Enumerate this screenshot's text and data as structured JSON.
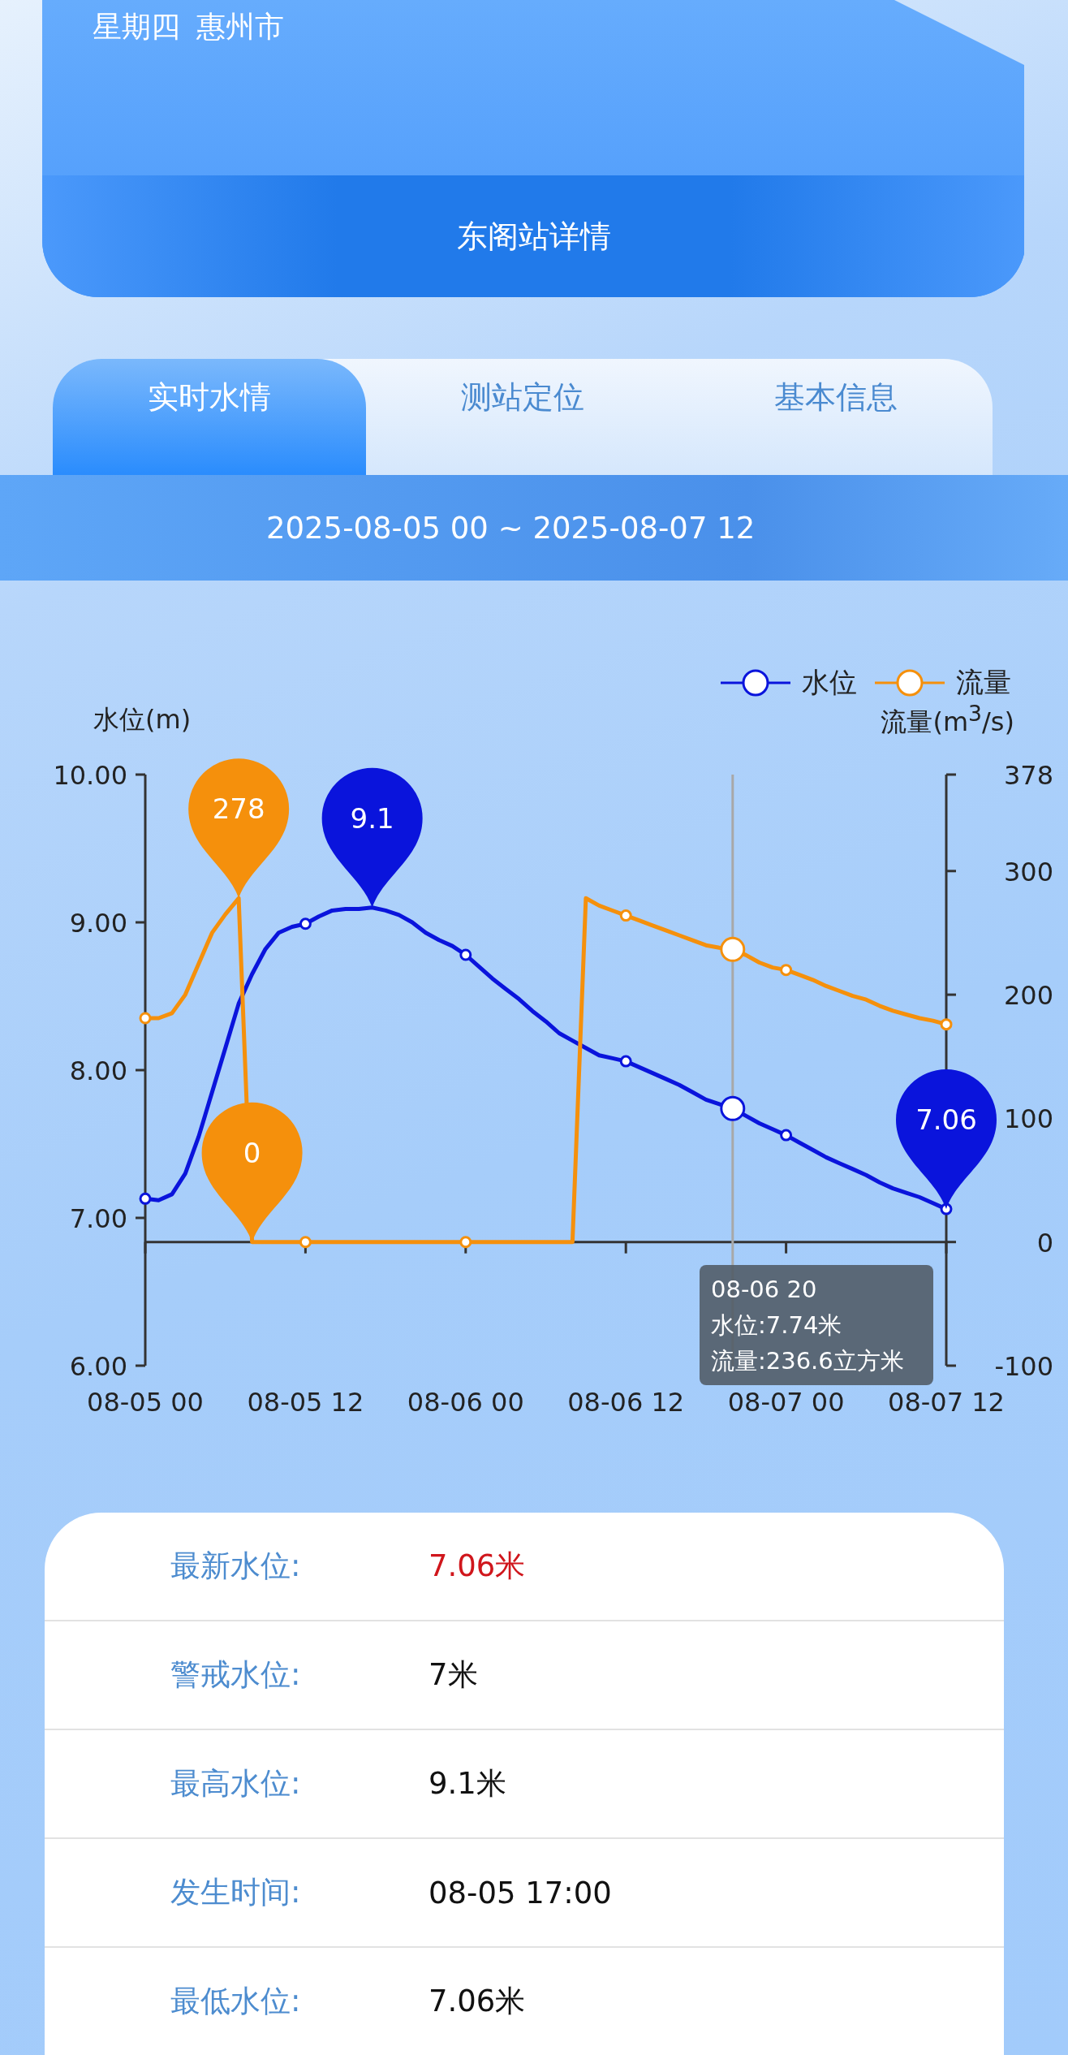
{
  "header": {
    "weekday": "星期四",
    "city": "惠州市",
    "station_title": "东阁站详情"
  },
  "tabs": [
    {
      "label": "实时水情",
      "selected": true
    },
    {
      "label": "测站定位",
      "selected": false
    },
    {
      "label": "基本信息",
      "selected": false
    }
  ],
  "date_range": "2025-08-05 00 ~ 2025-08-07 12",
  "chart": {
    "chart_data": {
      "type": "line",
      "ylabel": "水位(m)",
      "y2label": "流量(m$^{3}$/s)",
      "categories": [
        "08-05 00",
        null,
        null,
        null,
        null,
        null,
        null,
        null,
        null,
        null,
        null,
        null,
        "08-05 12",
        null,
        null,
        null,
        null,
        null,
        null,
        null,
        null,
        null,
        null,
        null,
        "08-06 00",
        null,
        null,
        null,
        null,
        null,
        null,
        null,
        null,
        null,
        null,
        null,
        "08-06 12",
        null,
        null,
        null,
        null,
        null,
        null,
        null,
        null,
        null,
        null,
        null,
        "08-07 00",
        null,
        null,
        null,
        null,
        null,
        null,
        null,
        null,
        null,
        null,
        null,
        "08-07 12"
      ],
      "series": [
        {
          "name": "水位",
          "color": "#0a14dc",
          "values": [
            7.13,
            7.12,
            7.16,
            7.3,
            7.55,
            7.85,
            8.15,
            8.45,
            8.65,
            8.82,
            8.93,
            8.97,
            8.99,
            9.04,
            9.08,
            9.09,
            9.09,
            9.1,
            9.08,
            9.05,
            9.0,
            8.93,
            8.88,
            8.84,
            8.78,
            8.7,
            8.62,
            8.55,
            8.48,
            8.4,
            8.33,
            8.25,
            8.2,
            8.15,
            8.1,
            8.08,
            8.06,
            8.02,
            7.98,
            7.94,
            7.9,
            7.85,
            7.8,
            7.77,
            7.74,
            7.69,
            7.64,
            7.6,
            7.56,
            7.51,
            7.46,
            7.41,
            7.37,
            7.33,
            7.29,
            7.24,
            7.2,
            7.17,
            7.14,
            7.1,
            7.06
          ]
        },
        {
          "name": "流量",
          "color": "#f5900c",
          "axis": "y2",
          "values": [
            181,
            181,
            185,
            200,
            225,
            250,
            265,
            278,
            0,
            0,
            0,
            0,
            0,
            0,
            0,
            0,
            0,
            0,
            0,
            0,
            0,
            0,
            0,
            0,
            0,
            0,
            0,
            0,
            0,
            0,
            0,
            0,
            0,
            278,
            272,
            268,
            264,
            260,
            256,
            252,
            248,
            244,
            240,
            238,
            236.6,
            232,
            226,
            222,
            220,
            216,
            212,
            207,
            203,
            199,
            196,
            191,
            187,
            184,
            181,
            179,
            176
          ]
        }
      ],
      "ylim": [
        6,
        10
      ],
      "yticks": [
        {
          "value": 10,
          "label": "10.00"
        },
        {
          "value": 9,
          "label": "9.00"
        },
        {
          "value": 8,
          "label": "8.00"
        },
        {
          "value": 7,
          "label": "7.00"
        },
        {
          "value": 6,
          "label": "6.00"
        }
      ],
      "y2lim": [
        -100,
        378
      ],
      "y2ticks": [
        {
          "value": 378,
          "label": "378"
        },
        {
          "value": 300,
          "label": "300"
        },
        {
          "value": 200,
          "label": "200"
        },
        {
          "value": 100,
          "label": "100"
        },
        {
          "value": 0,
          "label": "0"
        },
        {
          "value": -100,
          "label": "-100"
        }
      ],
      "annotations": [
        "9.1",
        "7.06",
        "278",
        "0"
      ]
    },
    "tooltip": {
      "title": "08-06 20",
      "lines": [
        "水位:7.74米",
        "流量:236.6立方米"
      ]
    }
  },
  "info_rows": [
    {
      "label": "最新水位:",
      "value": "7.06米",
      "color": "#d0161c"
    },
    {
      "label": "警戒水位:",
      "value": "7米",
      "color": "#111111"
    },
    {
      "label": "最高水位:",
      "value": "9.1米",
      "color": "#111111"
    },
    {
      "label": "发生时间:",
      "value": "08-05 17:00",
      "color": "#111111"
    },
    {
      "label": "最低水位:",
      "value": "7.06米",
      "color": "#111111"
    }
  ]
}
